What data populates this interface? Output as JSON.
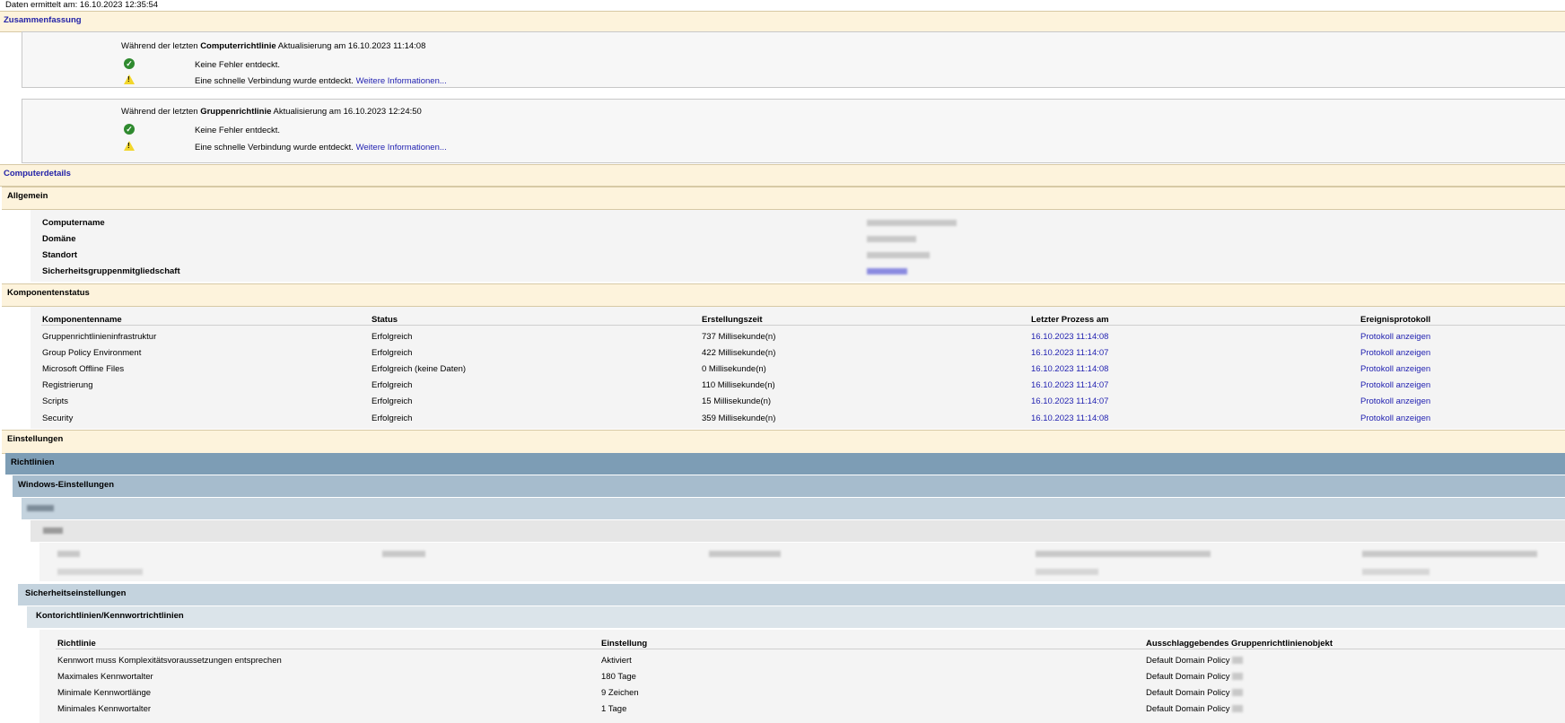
{
  "report_timestamp": "Daten ermittelt am: 16.10.2023 12:35:54",
  "summary": {
    "title": "Zusammenfassung",
    "computer": {
      "prefix": "Während der letzten",
      "policy": "Computerrichtlinie",
      "suffix": "Aktualisierung am 16.10.2023 11:14:08",
      "ok_text": "Keine Fehler entdeckt.",
      "warn_text": "Eine schnelle Verbindung wurde entdeckt.",
      "more_link": "Weitere Informationen..."
    },
    "group": {
      "prefix": "Während der letzten",
      "policy": "Gruppenrichtlinie",
      "suffix": "Aktualisierung am 16.10.2023 12:24:50",
      "ok_text": "Keine Fehler entdeckt.",
      "warn_text": "Eine schnelle Verbindung wurde entdeckt.",
      "more_link": "Weitere Informationen..."
    }
  },
  "computer_details": {
    "title": "Computerdetails",
    "general": {
      "title": "Allgemein",
      "labels": [
        "Computername",
        "Domäne",
        "Standort",
        "Sicherheitsgruppenmitgliedschaft"
      ]
    },
    "components": {
      "title": "Komponentenstatus",
      "headers": [
        "Komponentenname",
        "Status",
        "Erstellungszeit",
        "Letzter Prozess am",
        "Ereignisprotokoll"
      ],
      "rows": [
        [
          "Gruppenrichtlinieninfrastruktur",
          "Erfolgreich",
          "737 Millisekunde(n)",
          "16.10.2023 11:14:08",
          "Protokoll anzeigen"
        ],
        [
          "Group Policy Environment",
          "Erfolgreich",
          "422 Millisekunde(n)",
          "16.10.2023 11:14:07",
          "Protokoll anzeigen"
        ],
        [
          "Microsoft Offline Files",
          "Erfolgreich (keine Daten)",
          "0 Millisekunde(n)",
          "16.10.2023 11:14:08",
          "Protokoll anzeigen"
        ],
        [
          "Registrierung",
          "Erfolgreich",
          "110 Millisekunde(n)",
          "16.10.2023 11:14:07",
          "Protokoll anzeigen"
        ],
        [
          "Scripts",
          "Erfolgreich",
          "15 Millisekunde(n)",
          "16.10.2023 11:14:07",
          "Protokoll anzeigen"
        ],
        [
          "Security",
          "Erfolgreich",
          "359 Millisekunde(n)",
          "16.10.2023 11:14:08",
          "Protokoll anzeigen"
        ]
      ]
    }
  },
  "settings": {
    "title": "Einstellungen",
    "policies": "Richtlinien",
    "windows_settings": "Windows-Einstellungen",
    "security_settings": "Sicherheitseinstellungen",
    "account_policies": "Kontorichtlinien/Kennwortrichtlinien",
    "headers": [
      "Richtlinie",
      "Einstellung",
      "Ausschlaggebendes Gruppenrichtlinienobjekt"
    ],
    "rows": [
      [
        "Kennwort muss Komplexitätsvoraussetzungen entsprechen",
        "Aktiviert",
        "Default Domain Policy"
      ],
      [
        "Maximales Kennwortalter",
        "180 Tage",
        "Default Domain Policy"
      ],
      [
        "Minimale Kennwortlänge",
        "9 Zeichen",
        "Default Domain Policy"
      ],
      [
        "Minimales Kennwortalter",
        "1 Tage",
        "Default Domain Policy"
      ]
    ]
  }
}
